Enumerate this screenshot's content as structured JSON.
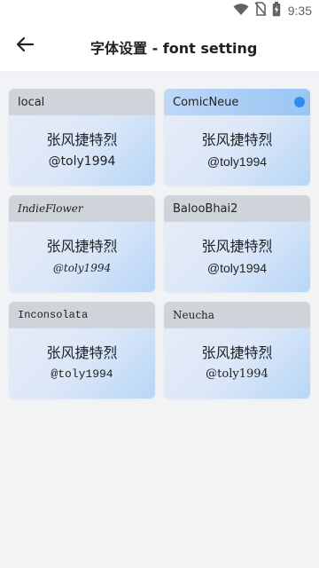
{
  "status_bar": {
    "time": "9:35",
    "icons": [
      "wifi-icon",
      "no-sim-icon",
      "battery-charging-icon"
    ]
  },
  "app_bar": {
    "title": "字体设置 - font setting",
    "back_icon": "arrow-left-icon"
  },
  "fonts": [
    {
      "name": "local",
      "sample_cn": "张风捷特烈",
      "sample_handle": "@toly1994",
      "selected": false
    },
    {
      "name": "ComicNeue",
      "sample_cn": "张风捷特烈",
      "sample_handle": "@toly1994",
      "selected": true
    },
    {
      "name": "IndieFlower",
      "sample_cn": "张风捷特烈",
      "sample_handle": "@toly1994",
      "selected": false
    },
    {
      "name": "BalooBhai2",
      "sample_cn": "张风捷特烈",
      "sample_handle": "@toly1994",
      "selected": false
    },
    {
      "name": "Inconsolata",
      "sample_cn": "张风捷特烈",
      "sample_handle": "@toly1994",
      "selected": false
    },
    {
      "name": "Neucha",
      "sample_cn": "张风捷特烈",
      "sample_handle": "@toly1994",
      "selected": false
    }
  ],
  "colors": {
    "page_background": "#f2f3f5",
    "header_gray": "#cfd4db",
    "selected_header": "#98c6f3",
    "selected_indicator": "#2f8cf2",
    "card_gradient_end": "#b7d6f6"
  }
}
